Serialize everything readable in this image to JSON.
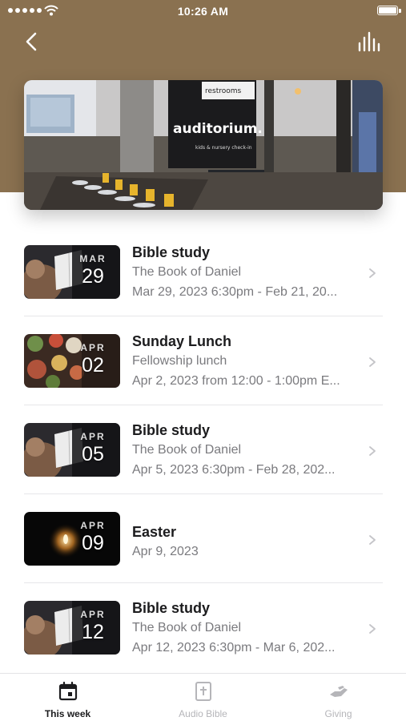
{
  "status_bar": {
    "time": "10:26 AM"
  },
  "header": {
    "back_icon": "chevron-left-icon",
    "audio_icon": "audio-bars-icon"
  },
  "hero": {
    "sign_text": "auditorium.",
    "sign_small": "kids & nursery check-in",
    "restroom_text": "restrooms"
  },
  "events": [
    {
      "thumb": "bible",
      "month": "MAR",
      "day": "29",
      "title": "Bible study",
      "subtitle": "The Book of Daniel",
      "when": "Mar 29, 2023 6:30pm - Feb 21, 20..."
    },
    {
      "thumb": "food",
      "month": "APR",
      "day": "02",
      "title": "Sunday Lunch",
      "subtitle": "Fellowship lunch",
      "when": "Apr 2, 2023 from 12:00 - 1:00pm E..."
    },
    {
      "thumb": "bible",
      "month": "APR",
      "day": "05",
      "title": "Bible study",
      "subtitle": "The Book of Daniel",
      "when": "Apr 5, 2023 6:30pm - Feb 28, 202..."
    },
    {
      "thumb": "candle",
      "month": "APR",
      "day": "09",
      "title": "Easter",
      "subtitle": "Apr 9, 2023",
      "when": ""
    },
    {
      "thumb": "bible",
      "month": "APR",
      "day": "12",
      "title": "Bible study",
      "subtitle": "The Book of Daniel",
      "when": "Apr 12, 2023 6:30pm - Mar 6, 202..."
    }
  ],
  "tabs": [
    {
      "label": "This week",
      "icon": "calendar-icon",
      "active": true
    },
    {
      "label": "Audio Bible",
      "icon": "bible-cross-icon",
      "active": false
    },
    {
      "label": "Giving",
      "icon": "giving-hand-icon",
      "active": false
    }
  ],
  "colors": {
    "header": "#8a7150",
    "accent": "#1c1c1e",
    "muted": "#7a7a7e"
  }
}
